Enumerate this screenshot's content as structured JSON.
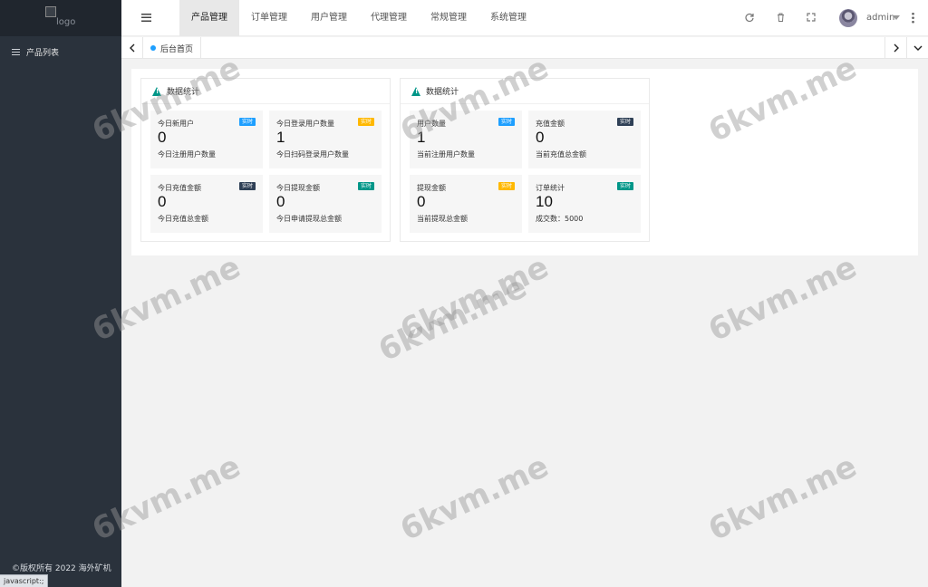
{
  "sidebar": {
    "logo_alt": "logo",
    "items": [
      {
        "label": "产品列表",
        "icon": "list-icon"
      }
    ],
    "copyright": "©版权所有 2022 海外矿机"
  },
  "status_text": "javascript:;",
  "header": {
    "nav": [
      "产品管理",
      "订单管理",
      "用户管理",
      "代理管理",
      "常规管理",
      "系统管理"
    ],
    "active_index": 0,
    "icons": [
      "refresh-icon",
      "trash-icon",
      "fullscreen-icon"
    ],
    "user": "admin"
  },
  "tabbar": {
    "current_tab": "后台首页"
  },
  "panels": [
    {
      "title": "数据统计",
      "stats": [
        {
          "label": "今日新用户",
          "badge": "实时",
          "value": "0",
          "desc": "今日注册用户数量",
          "color": "#1e9fff"
        },
        {
          "label": "今日登录用户数量",
          "badge": "实时",
          "value": "1",
          "desc": "今日扫码登录用户数量",
          "color": "#ffb800"
        },
        {
          "label": "今日充值金额",
          "badge": "实时",
          "value": "0",
          "desc": "今日充值总金额",
          "color": "#2f4056"
        },
        {
          "label": "今日提现金额",
          "badge": "实时",
          "value": "0",
          "desc": "今日申请提现总金额",
          "color": "#009688"
        }
      ]
    },
    {
      "title": "数据统计",
      "stats": [
        {
          "label": "用户数量",
          "badge": "实时",
          "value": "1",
          "desc": "当前注册用户数量",
          "color": "#1e9fff"
        },
        {
          "label": "充值金额",
          "badge": "实时",
          "value": "0",
          "desc": "当前充值总金额",
          "color": "#2f4056"
        },
        {
          "label": "提现金额",
          "badge": "实时",
          "value": "0",
          "desc": "当前提现总金额",
          "color": "#ffb800"
        },
        {
          "label": "订单统计",
          "badge": "实时",
          "value": "10",
          "desc": "成交数：5000",
          "color": "#009688"
        }
      ]
    }
  ],
  "watermark": "6kvm.me"
}
